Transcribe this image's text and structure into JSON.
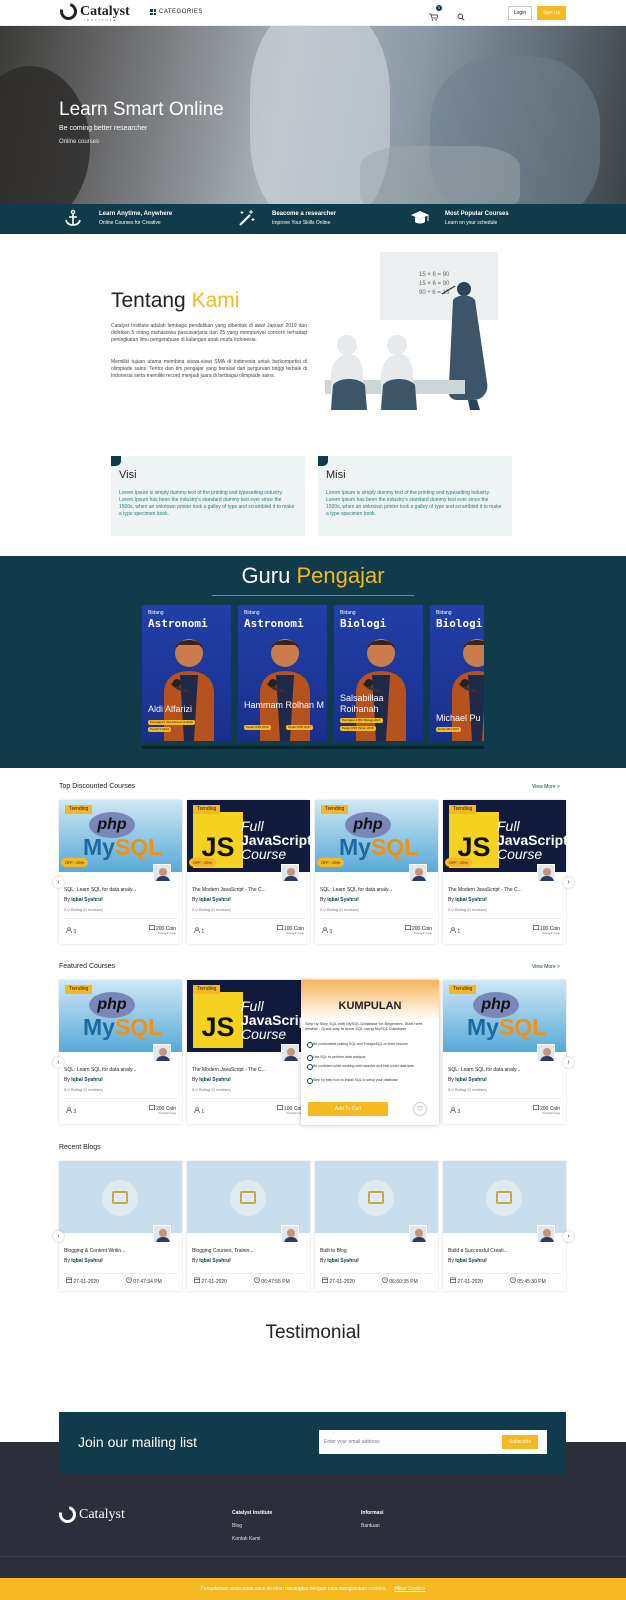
{
  "header": {
    "logo": "Catalyst",
    "logo_sub": "INSTITUTE",
    "categories": "CATEGORIES",
    "cart_count": "0",
    "login": "Login",
    "signup": "Sign Up"
  },
  "hero": {
    "title": "Learn Smart Online",
    "subtitle": "Be coming better researcher",
    "subtitle2": "Online courses"
  },
  "features": [
    {
      "title": "Learn Anytime, Anywhere",
      "sub": "Online Courses for Creative"
    },
    {
      "title": "Beacome a researcher",
      "sub": "Improve Your Skills Online"
    },
    {
      "title": "Most Popular Courses",
      "sub": "Learn on your schedule"
    }
  ],
  "about": {
    "title_a": "Tentang ",
    "title_b": "Kami",
    "p1": "Catalyst Institute adalah lembaga pendidikan yang dibentuk di awal Januari 2019 dan didirikan 5 orang mahasiswa pascasarjana dan 25 yang mempunyai concern terhadap peningkatan ilmu pengetahuan di kalangan anak muda Indonesia.",
    "p2": "Memiliki tujuan utama membina siswa-siswi SMA di Indonesia untuk berkompetisi di olimpiade sains. Tentor dan tim pengajar yang berasal dari perguruan tinggi terbaik di Indonesia serta memiliki record menjadi juara di berbagai olimpiade sains.",
    "board": [
      "15 × 6 = 90",
      "15 × 6 = 90",
      "90 ÷ 6 = 15"
    ]
  },
  "visi": {
    "title": "Visi",
    "text": "Lorem Ipsum is simply dummy text of the printing and typesetting industry. Lorem Ipsum has been the industry's standard dummy text ever since the 1500s, when an unknown printer took a galley of type and scrambled it to make a type specimen book."
  },
  "misi": {
    "title": "Misi",
    "text": "Lorem Ipsum is simply dummy text of the printing and typesetting industry. Lorem Ipsum has been the industry's standard dummy text ever since the 1500s, when an unknown printer took a galley of type and scrambled it to make a type specimen book."
  },
  "guru": {
    "title_a": "Guru ",
    "title_b": "Pengajar",
    "cards": [
      {
        "label": "Bidang",
        "subject": "Astronomi",
        "name": "Aldi Alfarizi",
        "tags": [
          "Peringkat 5 IOA Astronomi 2016",
          "Peraih 5 IOAA"
        ]
      },
      {
        "label": "Bidang",
        "subject": "Astronomi",
        "name": "Hammam Rolhan M",
        "tags": [
          "Perak OSN 2016",
          "Perak OSN 2017"
        ]
      },
      {
        "label": "Bidang",
        "subject": "Biologi",
        "name": "Salsabillaa Roihanah",
        "tags": [
          "Peringkat 4 IBO Biologi 2017",
          "Perak OSN Tahun 2016"
        ]
      },
      {
        "label": "Bidang",
        "subject": "Biologi",
        "name": "Michael Pu",
        "tags": [
          "Emas IBO 2017"
        ]
      }
    ]
  },
  "top_discounted": {
    "title": "Top Discounted Courses",
    "view_more": "View More >",
    "courses": [
      {
        "img": "php",
        "tag": "Trending",
        "off": "OFF : 25%",
        "title": "SQL: Learn SQL for data analy...",
        "by": "By",
        "author": "Iqbal Syahrul",
        "rating": "5.0 Rating (0 reviews)",
        "students": "3",
        "coin": "200 Coin",
        "coin_old": "Potongan harga"
      },
      {
        "img": "js",
        "tag": "Trending",
        "off": "OFF : 25%",
        "title": "The Modern JavaScript - The C...",
        "by": "By",
        "author": "Iqbal Syahrul",
        "rating": "5.0 Rating (0 reviews)",
        "students": "1",
        "coin": "100 Coin",
        "coin_old": "Potongan harga"
      },
      {
        "img": "php",
        "tag": "Trending",
        "off": "OFF : 25%",
        "title": "SQL: Learn SQL for data analy...",
        "by": "By",
        "author": "Iqbal Syahrul",
        "rating": "5.0 Rating (0 reviews)",
        "students": "3",
        "coin": "200 Coin",
        "coin_old": "Potongan harga"
      },
      {
        "img": "js",
        "tag": "Trending",
        "off": "OFF : 25%",
        "title": "The Modern JavaScript - The C...",
        "by": "By",
        "author": "Iqbal Syahrul",
        "rating": "5.0 Rating (0 reviews)",
        "students": "1",
        "coin": "100 Coin",
        "coin_old": "Potongan harga"
      }
    ]
  },
  "featured": {
    "title": "Featured Courses",
    "view_more": "View More >",
    "courses": [
      {
        "img": "php",
        "tag": "Trending",
        "title": "SQL: Learn SQL for data analy...",
        "by": "By",
        "author": "Iqbal Syahrul",
        "rating": "5.0 Rating (0 reviews)",
        "students": "3",
        "coin": "200 Coin",
        "coin_old": "Potongan harga"
      },
      {
        "img": "js",
        "tag": "Trending",
        "title": "The Modern JavaScript - The C...",
        "by": "By",
        "author": "Iqbal Syahrul",
        "rating": "5.0 Rating (0 reviews)",
        "students": "1",
        "coin": "100 Coin",
        "coin_old": "Potongan harga"
      },
      {
        "img": "php",
        "tag": "Trending",
        "title": "SQL: Learn SQL for data analy...",
        "by": "By",
        "author": "Iqbal Syahrul",
        "rating": "5.0 Rating (0 reviews)",
        "students": "3",
        "coin": "200 Coin",
        "coin_old": "Potongan harga"
      }
    ],
    "popup": {
      "heading": "KUMPULAN",
      "desc": "Step by Step SQL with MySQL Database for Beginners. Start here: newbie - Quick way to learn SQL using MySQL Database",
      "items": [
        "Be comfortable putting SQL and PostgreSQL on their resume",
        "Use SQL to perform data analysis",
        "Be confident while working with massive and real-world data sets",
        "Step by step how to install SQL to setup your database"
      ],
      "add": "Add To Cart",
      "heart": "♡"
    }
  },
  "blogs": {
    "title": "Recent Blogs",
    "items": [
      {
        "title": "Blogging & Content Writin...",
        "by": "By",
        "author": "Iqbal Syahrul",
        "date": "27-01-2020",
        "time": "07:47:34 PM"
      },
      {
        "title": "Blogging Courses, Trainin...",
        "by": "By",
        "author": "Iqbal Syahrul",
        "date": "27-01-2020",
        "time": "06:47:55 PM"
      },
      {
        "title": "Built to Blog",
        "by": "By",
        "author": "Iqbal Syahrul",
        "date": "27-01-2020",
        "time": "06:50:35 PM"
      },
      {
        "title": "Build a Successful Creati...",
        "by": "By",
        "author": "Iqbal Syahrul",
        "date": "27-01-2020",
        "time": "05:45:30 PM"
      }
    ]
  },
  "testimonial": "Testimonial",
  "mailing": {
    "title": "Join our mailing list",
    "placeholder": "Enter your email address",
    "button": "Subscribe"
  },
  "footer": {
    "logo": "Catalyst",
    "col1_title": "Catalyst Institute",
    "col1_items": [
      "Blog",
      "Kontak Kami"
    ],
    "col2_title": "Informasi",
    "col2_items": [
      "Bantuan"
    ]
  },
  "cookie": {
    "text": "Pengalaman anda pada situs ini akan meningkat dengan cara mengizinkan cookies.",
    "link": "Allow Cookies"
  },
  "colors": {
    "primary": "#0f3b4a",
    "accent": "#f5b820",
    "footer": "#2c2f3b"
  }
}
